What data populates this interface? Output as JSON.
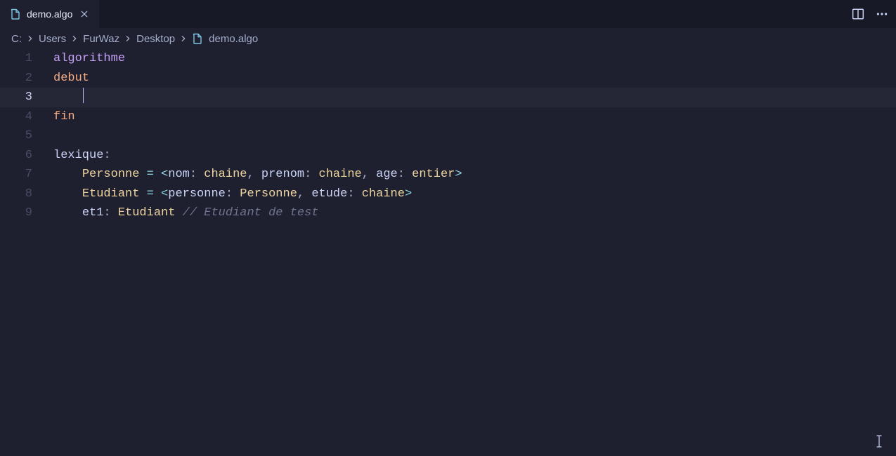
{
  "tab": {
    "file_name": "demo.algo",
    "close_tooltip": "Close"
  },
  "actions": {
    "split_tooltip": "Split Editor",
    "more_tooltip": "More Actions"
  },
  "breadcrumbs": {
    "segments": [
      "C:",
      "Users",
      "FurWaz",
      "Desktop"
    ],
    "file": "demo.algo"
  },
  "editor": {
    "active_line": 3,
    "lines": [
      {
        "n": 1,
        "tokens": [
          {
            "t": "algorithme",
            "c": "keyword1"
          }
        ]
      },
      {
        "n": 2,
        "tokens": [
          {
            "t": "debut",
            "c": "keyword2"
          }
        ]
      },
      {
        "n": 3,
        "indent": 1,
        "caret": true,
        "tokens": []
      },
      {
        "n": 4,
        "tokens": [
          {
            "t": "fin",
            "c": "keyword2"
          }
        ]
      },
      {
        "n": 5,
        "tokens": []
      },
      {
        "n": 6,
        "tokens": [
          {
            "t": "lexique",
            "c": "label"
          },
          {
            "t": ":",
            "c": "punct"
          }
        ]
      },
      {
        "n": 7,
        "indent": 1,
        "guide": true,
        "tokens": [
          {
            "t": "Personne",
            "c": "type"
          },
          {
            "t": " ",
            "c": ""
          },
          {
            "t": "=",
            "c": "op"
          },
          {
            "t": " ",
            "c": ""
          },
          {
            "t": "<",
            "c": "op"
          },
          {
            "t": "nom",
            "c": "label"
          },
          {
            "t": ":",
            "c": "punct"
          },
          {
            "t": " ",
            "c": ""
          },
          {
            "t": "chaine",
            "c": "type"
          },
          {
            "t": ",",
            "c": "punct"
          },
          {
            "t": " ",
            "c": ""
          },
          {
            "t": "prenom",
            "c": "label"
          },
          {
            "t": ":",
            "c": "punct"
          },
          {
            "t": " ",
            "c": ""
          },
          {
            "t": "chaine",
            "c": "type"
          },
          {
            "t": ",",
            "c": "punct"
          },
          {
            "t": " ",
            "c": ""
          },
          {
            "t": "age",
            "c": "label"
          },
          {
            "t": ":",
            "c": "punct"
          },
          {
            "t": " ",
            "c": ""
          },
          {
            "t": "entier",
            "c": "type"
          },
          {
            "t": ">",
            "c": "op"
          }
        ]
      },
      {
        "n": 8,
        "indent": 1,
        "guide": true,
        "tokens": [
          {
            "t": "Etudiant",
            "c": "type"
          },
          {
            "t": " ",
            "c": ""
          },
          {
            "t": "=",
            "c": "op"
          },
          {
            "t": " ",
            "c": ""
          },
          {
            "t": "<",
            "c": "op"
          },
          {
            "t": "personne",
            "c": "label"
          },
          {
            "t": ":",
            "c": "punct"
          },
          {
            "t": " ",
            "c": ""
          },
          {
            "t": "Personne",
            "c": "type"
          },
          {
            "t": ",",
            "c": "punct"
          },
          {
            "t": " ",
            "c": ""
          },
          {
            "t": "etude",
            "c": "label"
          },
          {
            "t": ":",
            "c": "punct"
          },
          {
            "t": " ",
            "c": ""
          },
          {
            "t": "chaine",
            "c": "type"
          },
          {
            "t": ">",
            "c": "op"
          }
        ]
      },
      {
        "n": 9,
        "indent": 1,
        "guide": true,
        "tokens": [
          {
            "t": "et1",
            "c": "ident"
          },
          {
            "t": ":",
            "c": "punct"
          },
          {
            "t": " ",
            "c": ""
          },
          {
            "t": "Etudiant",
            "c": "type"
          },
          {
            "t": " ",
            "c": ""
          },
          {
            "t": "// Etudiant de test",
            "c": "comment"
          }
        ]
      }
    ]
  },
  "colors": {
    "bg": "#1e2030",
    "tabbar": "#181926",
    "keyword1": "#c6a0f6",
    "keyword2": "#f5a97f",
    "type": "#eed49f",
    "op": "#91d7e3",
    "comment": "#6e738d",
    "text": "#cad3f5",
    "caret": "#b7bdf8"
  }
}
